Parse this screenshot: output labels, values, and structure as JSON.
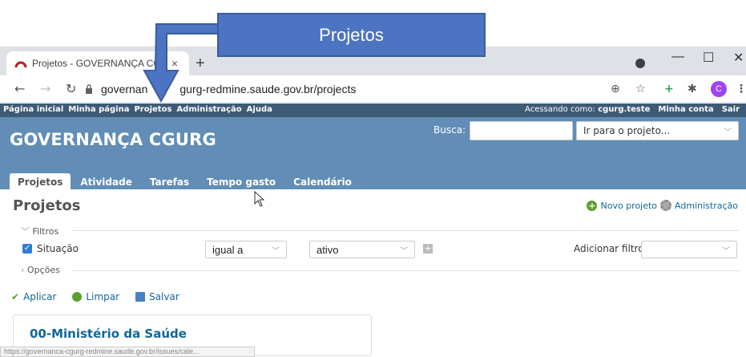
{
  "browser": {
    "tab_title": "Projetos - GOVERNANÇA CGURG",
    "tab_close": "×",
    "new_tab": "+",
    "url_host": "governança-cgurg-redmine.saude.gov.br",
    "url_path": "/projects",
    "url_display_start": "governan",
    "url_display_end": "gurg-redmine.saude.gov.br/projects",
    "profile_initial": "C",
    "window_minimize": "—",
    "window_maximize": "☐",
    "window_close": "✕",
    "status_url": "https://governanca-cgurg-redmine.saude.gov.br/issues/cale..."
  },
  "annotation": {
    "callout_text": "Projetos"
  },
  "topmenu": {
    "items": [
      "Página inicial",
      "Minha página",
      "Projetos",
      "Administração",
      "Ajuda"
    ],
    "logged_as_label": "Acessando como:",
    "logged_as_user": "cgurg.teste",
    "my_account": "Minha conta",
    "logout": "Sair"
  },
  "header": {
    "title": "GOVERNANÇA CGURG",
    "search_label": "Busca:",
    "jump_placeholder": "Ir para o projeto..."
  },
  "mainmenu": {
    "items": [
      "Projetos",
      "Atividade",
      "Tarefas",
      "Tempo gasto",
      "Calendário"
    ]
  },
  "content": {
    "page_title": "Projetos",
    "new_project": "Novo projeto",
    "administration": "Administração",
    "filters_legend": "Filtros",
    "options_legend": "Opções",
    "filter_status_label": "Situação",
    "filter_operator": "igual a",
    "filter_value": "ativo",
    "add_filter_label": "Adicionar filtro",
    "apply": "Aplicar",
    "clear": "Limpar",
    "save": "Salvar",
    "project_name": "00-Ministério da Saúde"
  }
}
